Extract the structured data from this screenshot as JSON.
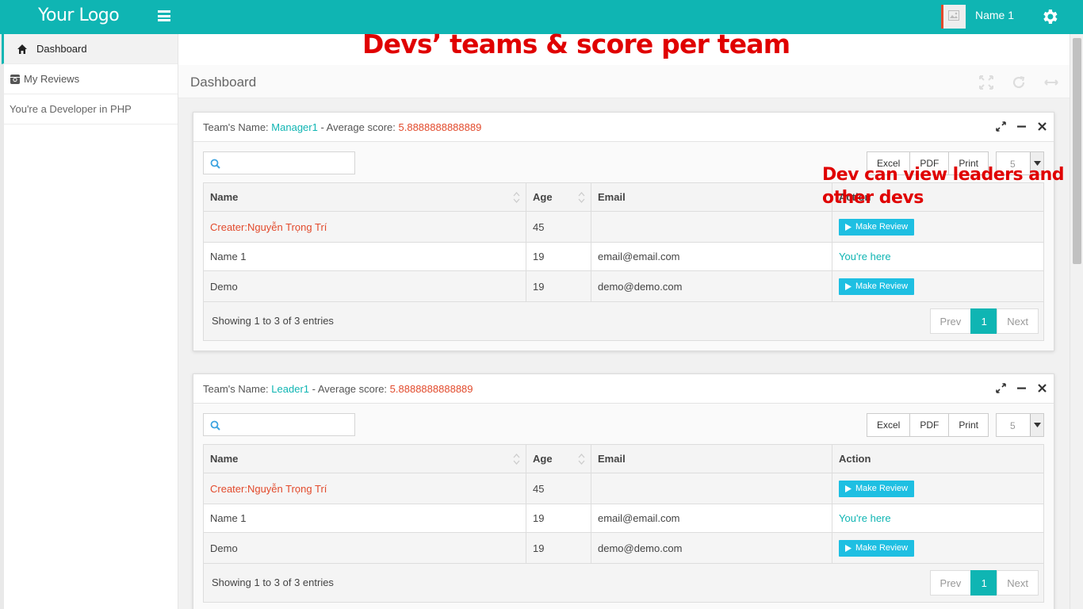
{
  "app": {
    "logo": "Your Logo",
    "user_name": "Name 1",
    "accent_color": "#0fb5b3"
  },
  "sidebar": {
    "items": [
      {
        "label": "Dashboard",
        "icon": "home-icon"
      },
      {
        "label": "My Reviews",
        "icon": "instagram-icon"
      },
      {
        "label": "You're a Developer in PHP"
      }
    ]
  },
  "page": {
    "title": "Dashboard"
  },
  "annotations": {
    "title": "Devs’ teams & score per team",
    "note_line1": "Dev can view leaders and",
    "note_line2": "other devs"
  },
  "panels": [
    {
      "team_label": "Team's Name: ",
      "team_name": "Manager1",
      "score_label": " - Average score: ",
      "score": "5.8888888888889",
      "exports": [
        "Excel",
        "PDF",
        "Print"
      ],
      "per_page": "5",
      "columns": [
        "Name",
        "Age",
        "Email",
        "Action"
      ],
      "rows": [
        {
          "name": "Creater:Nguyễn Trọng Trí",
          "age": "45",
          "email": "",
          "action": "Make Review"
        },
        {
          "name": "Name 1",
          "age": "19",
          "email": "email@email.com",
          "action": "You're here"
        },
        {
          "name": "Demo",
          "age": "19",
          "email": "demo@demo.com",
          "action": "Make Review"
        }
      ],
      "info": "Showing 1 to 3 of 3 entries",
      "pager": {
        "prev": "Prev",
        "current": "1",
        "next": "Next"
      }
    },
    {
      "team_label": "Team's Name: ",
      "team_name": "Leader1",
      "score_label": " - Average score: ",
      "score": "5.8888888888889",
      "exports": [
        "Excel",
        "PDF",
        "Print"
      ],
      "per_page": "5",
      "columns": [
        "Name",
        "Age",
        "Email",
        "Action"
      ],
      "rows": [
        {
          "name": "Creater:Nguyễn Trọng Trí",
          "age": "45",
          "email": "",
          "action": "Make Review"
        },
        {
          "name": "Name 1",
          "age": "19",
          "email": "email@email.com",
          "action": "You're here"
        },
        {
          "name": "Demo",
          "age": "19",
          "email": "demo@demo.com",
          "action": "Make Review"
        }
      ],
      "info": "Showing 1 to 3 of 3 entries",
      "pager": {
        "prev": "Prev",
        "current": "1",
        "next": "Next"
      }
    }
  ]
}
